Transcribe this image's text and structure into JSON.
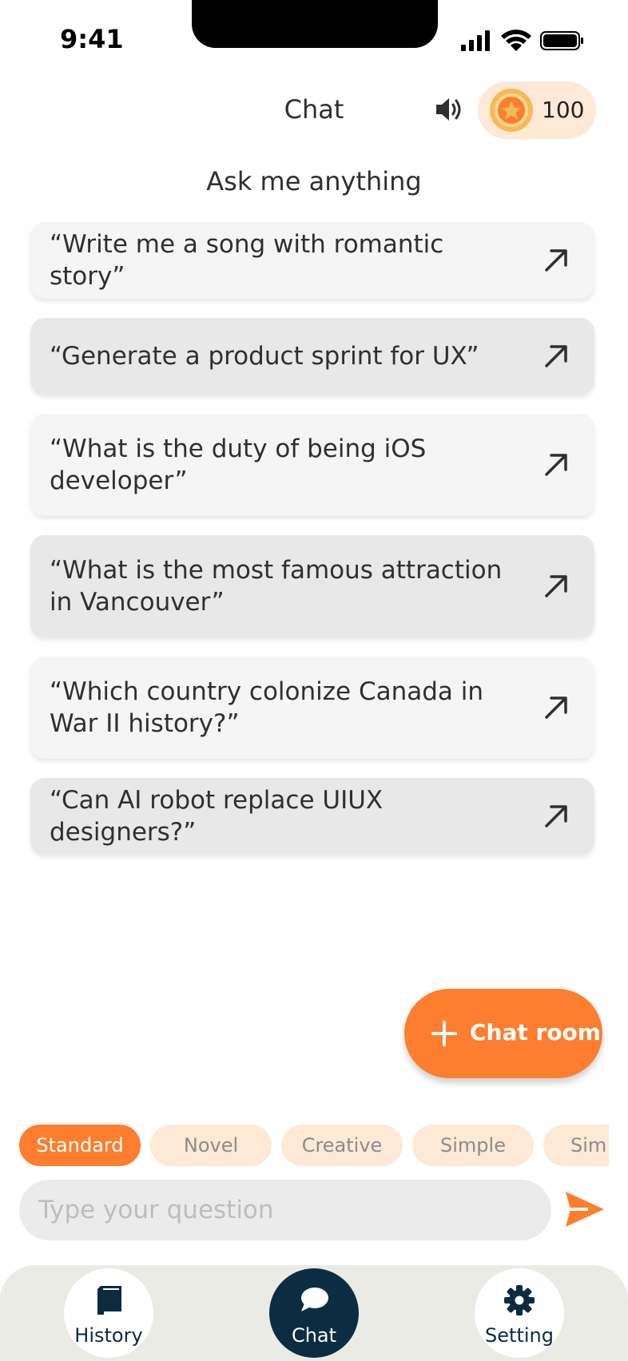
{
  "status_bar": {
    "time": "9:41"
  },
  "header": {
    "title": "Chat",
    "coins": "100"
  },
  "subtitle": "Ask me anything",
  "suggestions": [
    "“Write me a song with romantic story”",
    "“Generate a product sprint for UX”",
    "“What is the duty of being iOS developer”",
    "“What is the most famous attraction in Vancouver”",
    "“Which country colonize Canada in War II history?”",
    "“Can AI robot replace UIUX designers?”"
  ],
  "fab": {
    "label": "Chat room"
  },
  "modes": [
    "Standard",
    "Novel",
    "Creative",
    "Simple",
    "Sim"
  ],
  "active_mode": "Standard",
  "input": {
    "placeholder": "Type your question",
    "value": ""
  },
  "nav": {
    "history": "History",
    "chat": "Chat",
    "setting": "Setting",
    "active": "Chat"
  },
  "colors": {
    "accent": "#fd7e2e",
    "accent_light": "#fde9d6",
    "nav_active": "#0c2d41",
    "card_light": "#f5f5f5",
    "card_dark": "#e8e8e8"
  },
  "icons": [
    "signal-icon",
    "wifi-icon",
    "battery-icon",
    "speaker-icon",
    "coin-star-icon",
    "arrow-up-right-icon",
    "plus-icon",
    "send-icon",
    "book-icon",
    "chat-bubble-icon",
    "gear-icon"
  ]
}
